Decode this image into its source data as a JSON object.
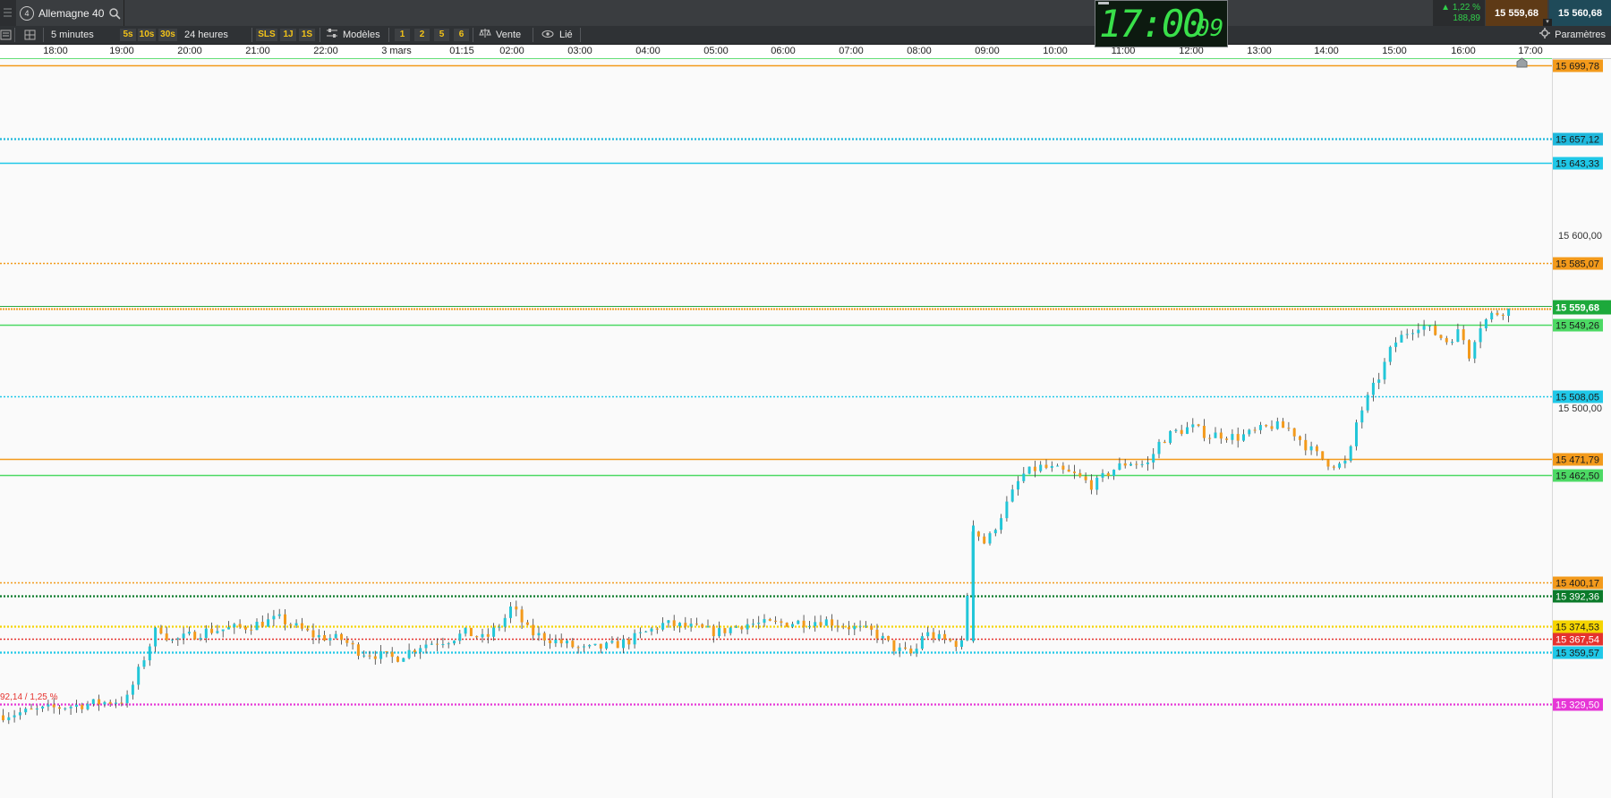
{
  "instrument": {
    "badge": "4",
    "name": "Allemagne 40"
  },
  "clock": {
    "hours_minutes": "17:00",
    "seconds": "09"
  },
  "quote": {
    "change_pct": "1,22 %",
    "change_abs": "188,89",
    "bid": "15 559,68",
    "ask": "15 560,68"
  },
  "toolbar": {
    "interval": "5 minutes",
    "quick_intervals": [
      "5s",
      "10s",
      "30s"
    ],
    "range": "24 heures",
    "periods": [
      "SLS",
      "1J",
      "1S"
    ],
    "templates_label": "Modèles",
    "layouts": [
      "1",
      "2",
      "5",
      "6"
    ],
    "trade_label": "Vente",
    "linked_label": "Lié",
    "settings_label": "Paramètres"
  },
  "time_axis": [
    "18:00",
    "19:00",
    "20:00",
    "21:00",
    "22:00",
    "3 mars",
    "01:15",
    "02:00",
    "03:00",
    "04:00",
    "05:00",
    "06:00",
    "07:00",
    "08:00",
    "09:00",
    "10:00",
    "11:00",
    "12:00",
    "13:00",
    "14:00",
    "15:00",
    "16:00",
    "17:00"
  ],
  "price_axis": {
    "ticks": [
      "15 600,00",
      "15 500,00"
    ],
    "last_price": "15 559,68",
    "open_ref_label": "92,14 / 1,25 %"
  },
  "levels": [
    {
      "label": "15 699,78",
      "price": 15699.78,
      "color": "#f39a1b",
      "style": "solid"
    },
    {
      "label": "15 657,12",
      "price": 15657.12,
      "color": "#1fb8dc",
      "style": "dotted"
    },
    {
      "label": "15 643,33",
      "price": 15643.33,
      "color": "#1fc8e8",
      "style": "solid"
    },
    {
      "label": "15 585,07",
      "price": 15585.07,
      "color": "#f39a1b",
      "style": "dotted"
    },
    {
      "label": "15 549,26",
      "price": 15549.26,
      "color": "#4cd964",
      "style": "solid"
    },
    {
      "label": "15 508,05",
      "price": 15508.05,
      "color": "#1fc8e8",
      "style": "dotted"
    },
    {
      "label": "15 471,79",
      "price": 15471.79,
      "color": "#f39a1b",
      "style": "solid"
    },
    {
      "label": "15 462,50",
      "price": 15462.5,
      "color": "#4cd964",
      "style": "solid"
    },
    {
      "label": "15 400,17",
      "price": 15400.17,
      "color": "#f39a1b",
      "style": "dotted"
    },
    {
      "label": "15 392,36",
      "price": 15392.36,
      "color": "#0b7a2a",
      "style": "dotted"
    },
    {
      "label": "15 374,53",
      "price": 15374.53,
      "color": "#f5d400",
      "style": "dotted"
    },
    {
      "label": "15 367,54",
      "price": 15367.54,
      "color": "#e5322e",
      "style": "dotted"
    },
    {
      "label": "15 359,57",
      "price": 15359.57,
      "color": "#1fc8e8",
      "style": "dotted"
    },
    {
      "label": "15 329,50",
      "price": 15329.5,
      "color": "#e636d6",
      "style": "dotted"
    }
  ],
  "price_path": [
    [
      0,
      15323
    ],
    [
      70,
      15328
    ],
    [
      140,
      15332
    ],
    [
      160,
      15357
    ],
    [
      175,
      15375
    ],
    [
      190,
      15366
    ],
    [
      230,
      15372
    ],
    [
      270,
      15374
    ],
    [
      310,
      15379
    ],
    [
      350,
      15369
    ],
    [
      380,
      15367
    ],
    [
      400,
      15360
    ],
    [
      440,
      15356
    ],
    [
      470,
      15364
    ],
    [
      500,
      15367
    ],
    [
      520,
      15371
    ],
    [
      540,
      15367
    ],
    [
      560,
      15377
    ],
    [
      570,
      15386
    ],
    [
      590,
      15371
    ],
    [
      620,
      15366
    ],
    [
      650,
      15361
    ],
    [
      680,
      15363
    ],
    [
      700,
      15366
    ],
    [
      720,
      15371
    ],
    [
      740,
      15376
    ],
    [
      770,
      15374
    ],
    [
      800,
      15371
    ],
    [
      830,
      15376
    ],
    [
      860,
      15376
    ],
    [
      890,
      15377
    ],
    [
      920,
      15378
    ],
    [
      950,
      15374
    ],
    [
      975,
      15371
    ],
    [
      1000,
      15361
    ],
    [
      1020,
      15358
    ],
    [
      1030,
      15371
    ],
    [
      1050,
      15367
    ],
    [
      1075,
      15364
    ],
    [
      1085,
      15432
    ],
    [
      1100,
      15422
    ],
    [
      1120,
      15442
    ],
    [
      1140,
      15462
    ],
    [
      1160,
      15467
    ],
    [
      1180,
      15465
    ],
    [
      1200,
      15462
    ],
    [
      1220,
      15456
    ],
    [
      1240,
      15465
    ],
    [
      1260,
      15470
    ],
    [
      1280,
      15468
    ],
    [
      1295,
      15482
    ],
    [
      1310,
      15487
    ],
    [
      1330,
      15490
    ],
    [
      1350,
      15485
    ],
    [
      1360,
      15486
    ],
    [
      1380,
      15484
    ],
    [
      1400,
      15487
    ],
    [
      1420,
      15491
    ],
    [
      1440,
      15489
    ],
    [
      1460,
      15478
    ],
    [
      1480,
      15470
    ],
    [
      1495,
      15468
    ],
    [
      1505,
      15470
    ],
    [
      1515,
      15495
    ],
    [
      1525,
      15505
    ],
    [
      1540,
      15520
    ],
    [
      1555,
      15538
    ],
    [
      1570,
      15545
    ],
    [
      1585,
      15550
    ],
    [
      1600,
      15545
    ],
    [
      1615,
      15540
    ],
    [
      1630,
      15546
    ],
    [
      1640,
      15532
    ],
    [
      1650,
      15548
    ],
    [
      1665,
      15555
    ],
    [
      1680,
      15558
    ],
    [
      1695,
      15557
    ]
  ]
}
